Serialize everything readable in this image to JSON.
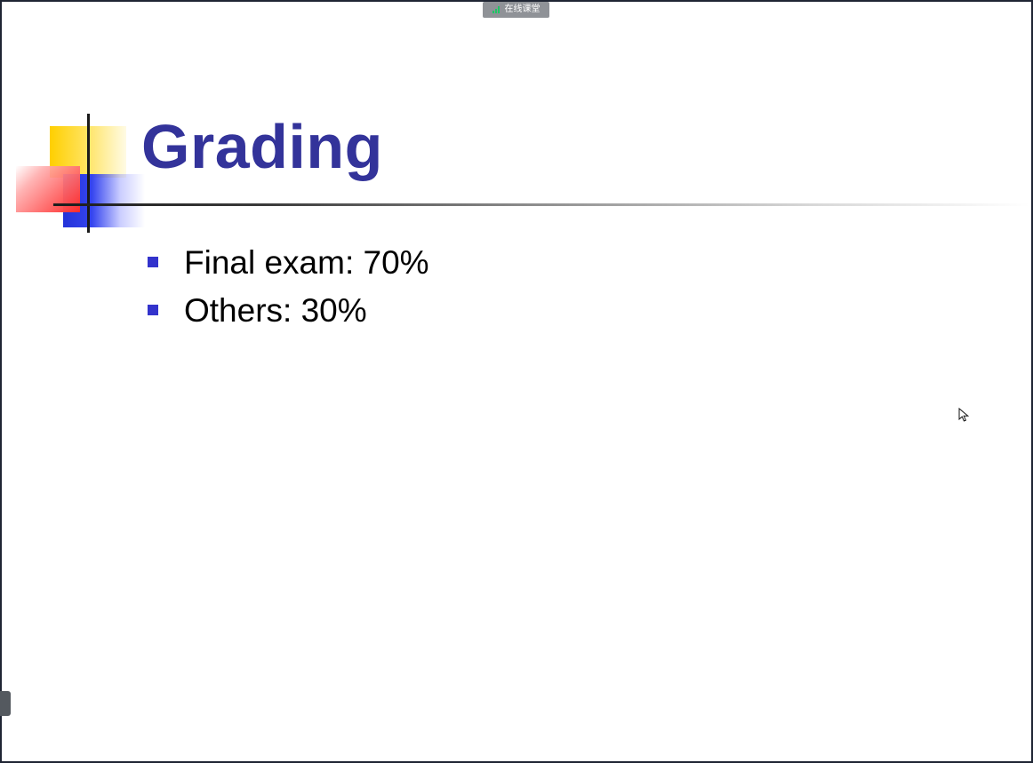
{
  "badge": {
    "label": "在线课堂",
    "icon": "signal-bars-icon",
    "color": "#8f9297"
  },
  "slide": {
    "title": "Grading",
    "bullets": [
      {
        "text": "Final exam: 70%"
      },
      {
        "text": "Others: 30%"
      }
    ],
    "colors": {
      "title": "#33339a",
      "bullet": "#3333cc",
      "logo_yellow": "#ffcf00",
      "logo_blue": "#3444ef",
      "logo_red": "#ff2b2b"
    }
  },
  "icons": {
    "cursor": "cursor-arrow-icon",
    "handle": "side-panel-handle-icon"
  }
}
